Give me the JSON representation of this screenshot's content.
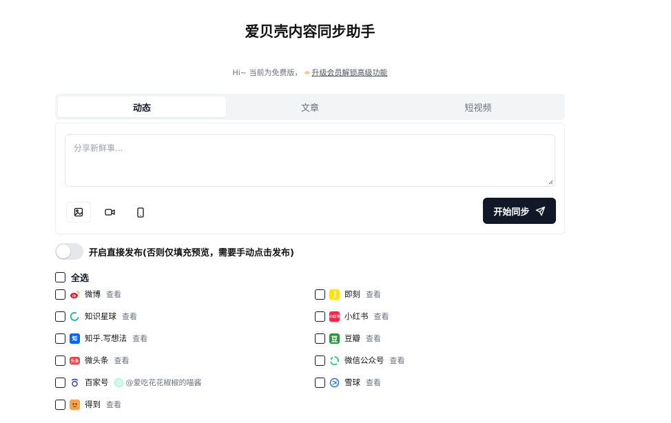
{
  "header": {
    "title": "爱贝壳内容同步助手",
    "subtitle_prefix": "Hi~ 当前为免费版，",
    "upgrade_link": "升级会员解锁高级功能"
  },
  "tabs": [
    {
      "label": "动态",
      "active": true
    },
    {
      "label": "文章",
      "active": false
    },
    {
      "label": "短视频",
      "active": false
    }
  ],
  "editor": {
    "placeholder": "分享新鲜事...",
    "value": ""
  },
  "toolbar": {
    "image_icon": "image-icon",
    "video_icon": "video-icon",
    "phone_icon": "phone-icon"
  },
  "sync_button": {
    "label": "开始同步",
    "icon": "send-icon"
  },
  "direct_publish": {
    "label": "开启直接发布(否则仅填充预览，需要手动点击发布)",
    "enabled": false
  },
  "select_all": {
    "label": "全选",
    "checked": false
  },
  "platforms_left": [
    {
      "name": "微博",
      "action": "查看",
      "icon": "weibo-icon",
      "color": "#e6162d"
    },
    {
      "name": "知识星球",
      "action": "查看",
      "icon": "zsxq-icon",
      "color": "#16b998"
    },
    {
      "name": "知乎.写想法",
      "action": "查看",
      "icon": "zhihu-icon",
      "color": "#0066ff"
    },
    {
      "name": "微头条",
      "action": "查看",
      "icon": "toutiao-icon",
      "color": "#f04142"
    },
    {
      "name": "百家号",
      "account": "@爱吃花花椒椒的喵酱",
      "icon": "baijiahao-icon",
      "color": "#2932e1"
    },
    {
      "name": "得到",
      "action": "查看",
      "icon": "dedao-icon",
      "color": "#f7a14a"
    }
  ],
  "platforms_right": [
    {
      "name": "即刻",
      "action": "查看",
      "icon": "jike-icon",
      "color": "#ffe411"
    },
    {
      "name": "小红书",
      "action": "查看",
      "icon": "xiaohongshu-icon",
      "color": "#ff2442",
      "badge": "小红书"
    },
    {
      "name": "豆瓣",
      "action": "查看",
      "icon": "douban-icon",
      "color": "#2e963d",
      "badge": "豆"
    },
    {
      "name": "微信公众号",
      "action": "查看",
      "icon": "wechat-mp-icon",
      "color": "#07c160"
    },
    {
      "name": "雪球",
      "action": "查看",
      "icon": "xueqiu-icon",
      "color": "#1f6cf5"
    }
  ],
  "toutiao_badge": "头条",
  "zhihu_badge": "知"
}
